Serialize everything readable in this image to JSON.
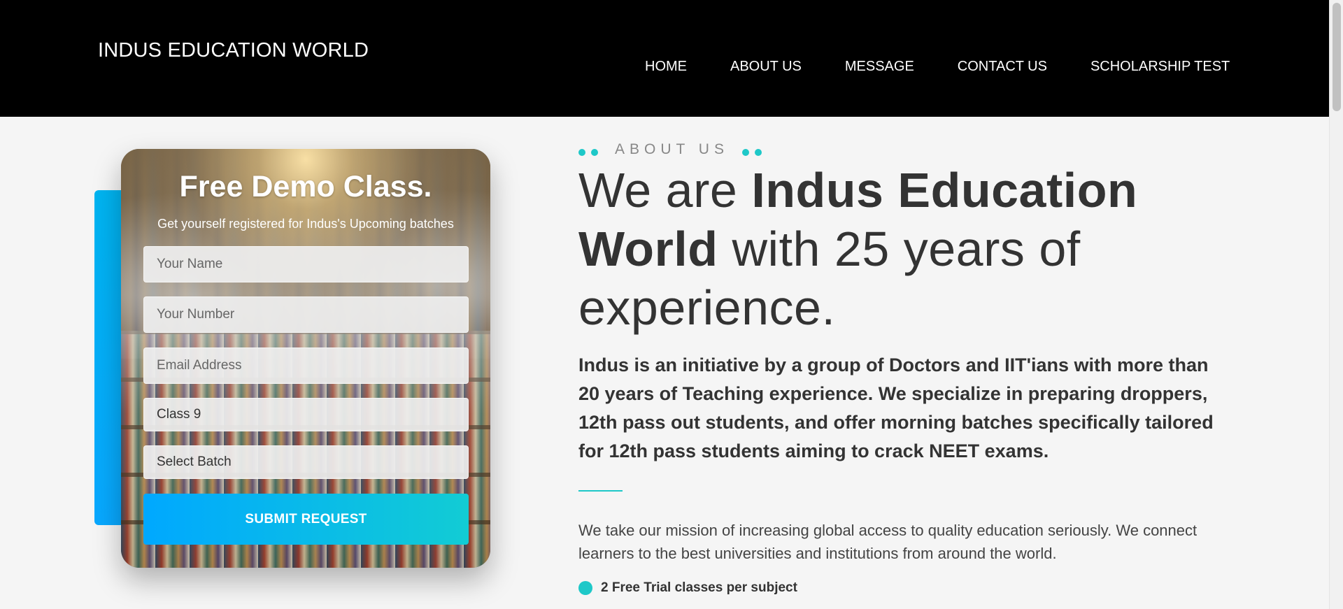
{
  "header": {
    "brand": "INDUS EDUCATION WORLD",
    "nav": [
      "HOME",
      "ABOUT US",
      "MESSAGE",
      "CONTACT US",
      "SCHOLARSHIP TEST"
    ]
  },
  "form": {
    "title": "Free Demo Class.",
    "subtitle": "Get yourself registered for Indus's Upcoming batches",
    "name_placeholder": "Your Name",
    "number_placeholder": "Your Number",
    "email_placeholder": "Email Address",
    "class_value": "Class 9",
    "batch_value": "Select Batch",
    "submit_label": "SUBMIT REQUEST"
  },
  "about": {
    "eyebrow": "ABOUT US",
    "headline_1": "We are ",
    "headline_bold": "Indus Education World",
    "headline_2": " with 25 years of experience.",
    "lead": "Indus is an initiative by a group of Doctors and IIT'ians with more than 20 years of Teaching experience. We specialize in preparing droppers, 12th pass out students, and offer morning batches specifically tailored for 12th pass students aiming to crack NEET exams.",
    "body": "We take our mission of increasing global access to quality education seriously. We connect learners to the best universities and institutions from around the world.",
    "bullets": [
      "2 Free Trial classes per subject"
    ]
  },
  "colors": {
    "header_bg": "#000000",
    "accent_teal": "#1ec8c8",
    "accent_blue": "#00a8ff",
    "page_bg": "#f5f5f5"
  }
}
